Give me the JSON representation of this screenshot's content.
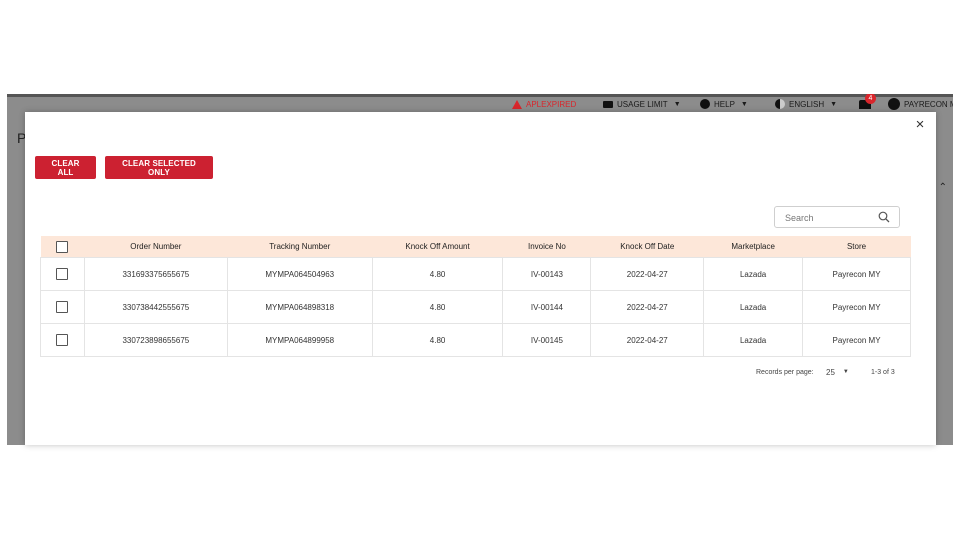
{
  "background": {
    "page_letter": "P",
    "header": {
      "alert_label": "APLEXPIRED",
      "usage_label": "USAGE LIMIT",
      "help_label": "HELP",
      "language_label": "ENGLISH",
      "notification_count": "4",
      "user_label": "PAYRECON M"
    }
  },
  "modal": {
    "close_symbol": "×",
    "buttons": {
      "clear_all": "CLEAR ALL",
      "clear_selected": "CLEAR SELECTED ONLY"
    },
    "search": {
      "placeholder": "Search",
      "value": ""
    },
    "table": {
      "columns": [
        "Order Number",
        "Tracking Number",
        "Knock Off Amount",
        "Invoice No",
        "Knock Off Date",
        "Marketplace",
        "Store"
      ],
      "rows": [
        [
          "331693375655675",
          "MYMPA064504963",
          "4.80",
          "IV-00143",
          "2022-04-27",
          "Lazada",
          "Payrecon MY"
        ],
        [
          "330738442555675",
          "MYMPA064898318",
          "4.80",
          "IV-00144",
          "2022-04-27",
          "Lazada",
          "Payrecon MY"
        ],
        [
          "330723898655675",
          "MYMPA064899958",
          "4.80",
          "IV-00145",
          "2022-04-27",
          "Lazada",
          "Payrecon MY"
        ]
      ]
    },
    "pagination": {
      "records_per_page_label": "Records per page:",
      "per_page": "25",
      "range": "1-3 of 3"
    }
  },
  "colors": {
    "primary_button": "#cc2131",
    "table_header": "#fde7d9",
    "alert": "#d9262c"
  }
}
